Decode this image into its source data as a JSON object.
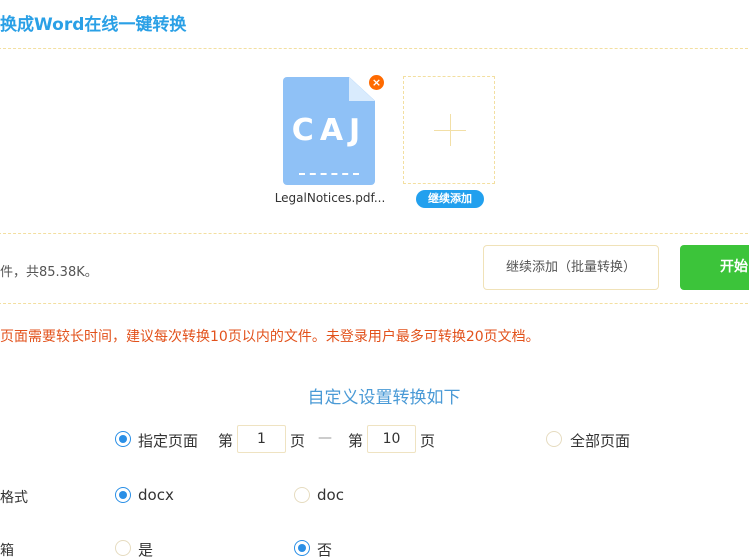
{
  "header": {
    "title": "换成Word在线一键转换"
  },
  "upload": {
    "file": {
      "extension": "CAJ",
      "name": "LegalNotices.pdf...",
      "remove_symbol": "×"
    },
    "add_more_label": "继续添加"
  },
  "summary": {
    "text": "件，共85.38K。",
    "batch_add_label": "继续添加（批量转换）",
    "start_label": "开始"
  },
  "warning": "页面需要较长时间，建议每次转换10页以内的文件。未登录用户最多可转换20页文档。",
  "settings": {
    "title": "自定义设置转换如下",
    "pages": {
      "specified_label": "指定页面",
      "specified_selected": true,
      "from_prefix": "第",
      "from_value": "1",
      "from_suffix": "页",
      "separator": "—",
      "to_prefix": "第",
      "to_value": "10",
      "to_suffix": "页",
      "all_label": "全部页面",
      "all_selected": false
    },
    "format": {
      "label": "格式",
      "options": [
        "docx",
        "doc"
      ],
      "selected": "docx"
    },
    "mailbox": {
      "label": "箱",
      "options": [
        "是",
        "否"
      ],
      "selected": "否"
    }
  },
  "colors": {
    "accent_blue": "#2aa0e6",
    "start_green": "#3cc43a",
    "warning_red": "#e2521c",
    "file_icon_blue": "#8fc1f6",
    "remove_orange": "#ff6a00"
  }
}
